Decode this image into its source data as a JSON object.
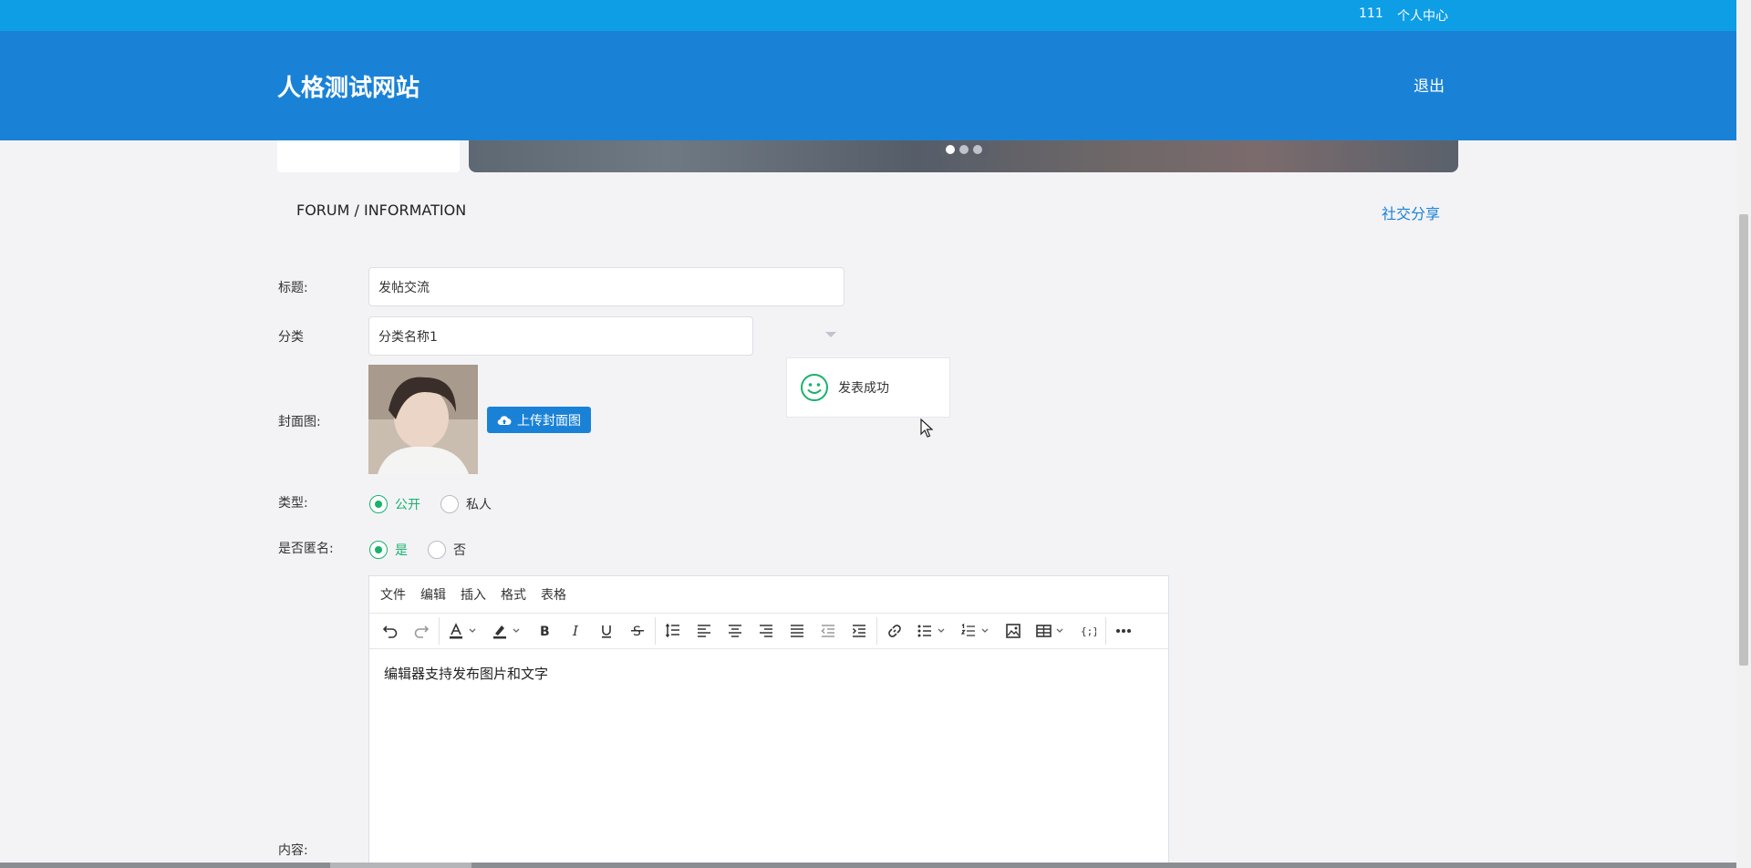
{
  "topbar": {
    "user": "111",
    "personal_center": "个人中心"
  },
  "header": {
    "logo": "人格测试网站",
    "logout": "退出"
  },
  "banner": {
    "slide_count": 3,
    "active_slide": 1
  },
  "page": {
    "breadcrumb": "FORUM / INFORMATION",
    "share": "社交分享"
  },
  "form": {
    "title_label": "标题:",
    "title_value": "发帖交流",
    "category_label": "分类",
    "category_value": "分类名称1",
    "cover_label": "封面图:",
    "upload_label": "上传封面图",
    "type_label": "类型:",
    "type_options": [
      "公开",
      "私人"
    ],
    "type_selected": "公开",
    "anon_label": "是否匿名:",
    "anon_options": [
      "是",
      "否"
    ],
    "anon_selected": "是",
    "content_label": "内容:"
  },
  "toast": {
    "message": "发表成功"
  },
  "editor": {
    "menus": [
      "文件",
      "编辑",
      "插入",
      "格式",
      "表格"
    ],
    "content": "编辑器支持发布图片和文字"
  },
  "colors": {
    "primary": "#1a82d6",
    "topbar": "#0e9ee6",
    "success": "#19b26b"
  }
}
